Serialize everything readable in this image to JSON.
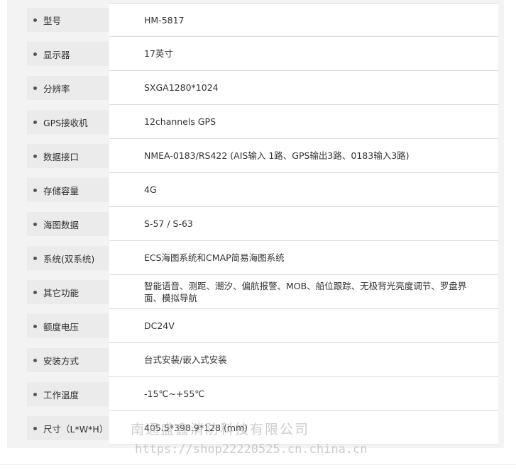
{
  "specs": [
    {
      "label": "型号",
      "value": "HM-5817"
    },
    {
      "label": "显示器",
      "value": "17英寸"
    },
    {
      "label": "分辨率",
      "value": "SXGA1280*1024"
    },
    {
      "label": "GPS接收机",
      "value": "12channels GPS"
    },
    {
      "label": "数据接口",
      "value": "NMEA-0183/RS422 (AIS输入 1路、GPS输出3路、0183输入3路)"
    },
    {
      "label": "存储容量",
      "value": "4G"
    },
    {
      "label": "海图数据",
      "value": "S-57 / S-63"
    },
    {
      "label": "系统(双系统)",
      "value": "ECS海图系统和CMAP简易海图系统"
    },
    {
      "label": "其它功能",
      "value": "智能语音、测距、潮汐、偏航报警、MOB、船位跟踪、无极背光亮度调节、罗盘界面、模拟导航"
    },
    {
      "label": "额度电压",
      "value": "DC24V"
    },
    {
      "label": "安装方式",
      "value": "台式安装/嵌入式安装"
    },
    {
      "label": "工作温度",
      "value": "-15℃~+55℃"
    },
    {
      "label": "尺寸（L*W*H）",
      "value": "405.5*398.9*128 (mm)"
    }
  ],
  "watermark": {
    "company": "南通盛鑫消防科技有限公司",
    "url": "https://shop22220525.cn.china.cn"
  }
}
